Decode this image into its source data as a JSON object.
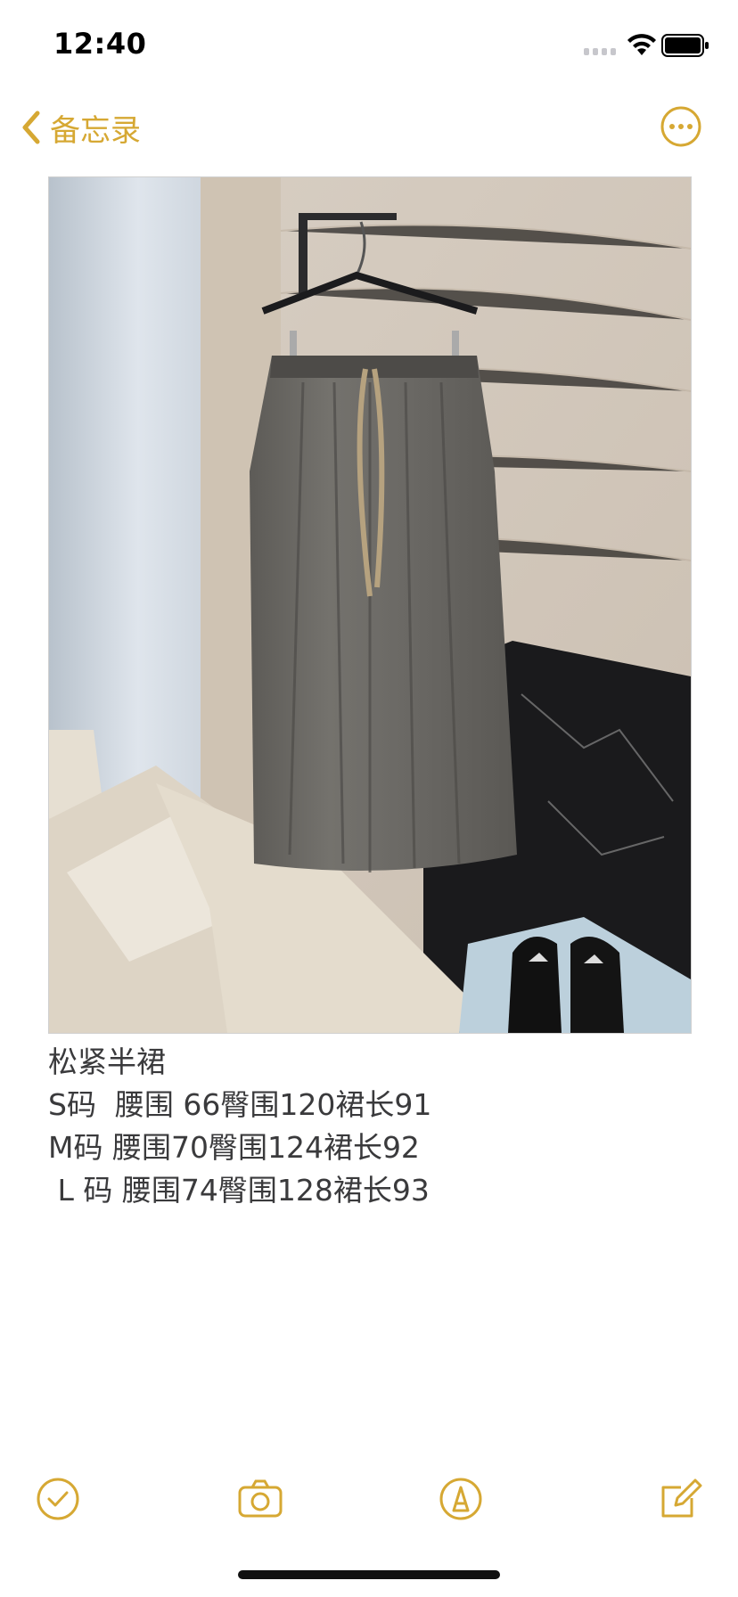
{
  "status_bar": {
    "time": "12:40"
  },
  "nav": {
    "back_label": "备忘录"
  },
  "note": {
    "title": "松紧半裙",
    "lines": [
      "S码  腰围 66臀围120裙长91",
      "M码 腰围70臀围124裙长92",
      " L 码 腰围74臀围128裙长93"
    ]
  },
  "toolbar": {
    "items": [
      "checklist-icon",
      "camera-icon",
      "markup-pen-icon",
      "compose-icon"
    ]
  },
  "colors": {
    "accent": "#d6a833",
    "text": "#3a3a3c",
    "background": "#ffffff"
  }
}
